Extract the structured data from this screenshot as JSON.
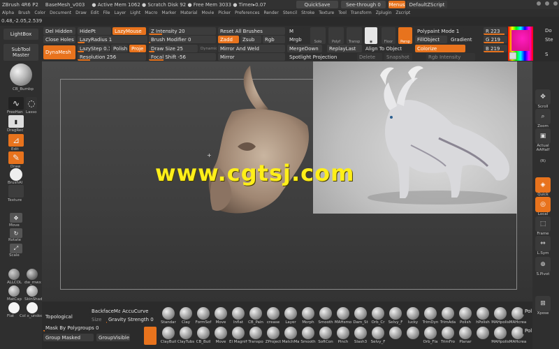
{
  "title_bar": {
    "app": "ZBrush 4R6 P2",
    "file": "BaseMesh_v003",
    "status": "● Active Mem 1062 ● Scratch Disk 92 ● Free Mem 3033 ● Timer▸0.07",
    "quicksave": "QuickSave",
    "see_through": "See-through  0",
    "menus": "Menus",
    "script": "DefaultZScript"
  },
  "menu_bar": [
    "Alpha",
    "Brush",
    "Color",
    "Document",
    "Draw",
    "Edit",
    "File",
    "Layer",
    "Light",
    "Macro",
    "Marker",
    "Material",
    "Movie",
    "Picker",
    "Preferences",
    "Render",
    "Stencil",
    "Stroke",
    "Texture",
    "Tool",
    "Transform",
    "Zplugin",
    "Zscript"
  ],
  "coords": "0.48,-2.05,2.539",
  "left_tray": {
    "lightbox": "LightBox",
    "subtool_master": "SubTool Master",
    "brush_name": "CB_Bumbp",
    "freehand": "FreeHan",
    "lasso": "Lasso",
    "dragrect": "DragRec",
    "edit": "Edit",
    "draw": "Draw",
    "brush_alpha": "BrushAl",
    "texture": "Texture",
    "move": "Move",
    "rotate": "Rotate",
    "scale": "Scale",
    "mat1": "ALLCOL",
    "mat2": "dw_mwx",
    "mat3": "MatCap",
    "mat4": "SkinShad",
    "mat5": "Flat",
    "mat6": "Col x_undoc"
  },
  "top_palette": {
    "del_hidden": "Del Hidden",
    "close_holes": "Close Holes",
    "dynamesh": "DynaMesh",
    "hide_pt": "HidePt",
    "lazy_radius": "LazyRadius 1",
    "lazy_step": "LazyStep 0.1",
    "polish": "Polish",
    "project": "Proje",
    "resolution": "Resolution 256",
    "lazy_mouse": "LazyMouse",
    "z_intensity": "Z Intensity 20",
    "brush_modifier": "Brush Modifier 0",
    "draw_size": "Draw Size 25",
    "dynamic": "Dynamic",
    "focal_shift": "Focal Shift -56",
    "reset_all_brushes": "Reset All Brushes",
    "zadd": "Zadd",
    "zsub": "Zsub",
    "rgb": "Rgb",
    "mirror_and_weld": "Mirror And Weld",
    "mirror": "Mirror",
    "m": "M",
    "mrgb": "Mrgb",
    "mergedown": "MergeDown",
    "spotlight": "Spotlight Projection",
    "solo": "Solo",
    "polyf": "Polyf",
    "transp": "Transp",
    "replay_last": "ReplayLast",
    "align_to_object": "Align To Object",
    "delete": "Delete",
    "snapshot": "Snapshot",
    "floor": "Floor",
    "persp": "Persp",
    "polypaint_mode": "Polypaint Mode 1",
    "fill_object": "FillObject",
    "gradient": "Gradient",
    "colorize": "Colorize",
    "rgb_intensity": "Rgb Intensity",
    "r": "R 223",
    "g": "G 219",
    "b": "B 219",
    "do": "Do",
    "st": "Ste",
    "s": "S"
  },
  "right_tray": [
    "Scroll",
    "Zoom",
    "Actual",
    "AAHalf",
    "(R)",
    "Quick",
    "Local",
    "Frame",
    "L.Sym",
    "S.Pivot",
    "Xpose"
  ],
  "canvas": {
    "watermark": "www.cgtsj.com"
  },
  "bottom_shelf": {
    "topological": "Topological",
    "backface": "BackfaceMas",
    "accucurve": "AccuCurve",
    "size": "Size",
    "gravity": "Gravity Strength 0",
    "mask_by_polygroups": "Mask By Polygroups 0",
    "group_masked": "Group Masked",
    "group_visible": "GroupVisible",
    "row1": [
      "Standar",
      "Clay",
      "FormSof",
      "Move",
      "Inflat",
      "CB_Pain",
      "crease",
      "Layer",
      "Morph",
      "Smooth",
      "MAHsmo",
      "Dam_St",
      "Orb_Cr",
      "Selvy_F",
      "lucky",
      "TrimDyn",
      "TrimAda",
      "Polish",
      "hPolish",
      "MAHpolis",
      "MAHcrea"
    ],
    "row2": [
      "ClayBuil",
      "ClayTubs",
      "CB_Buil",
      "Move",
      "El Magnify",
      "Transpo",
      "ZProject",
      "MatchMa",
      "Smooth",
      "SoftCon",
      "Pinch",
      "Slash3",
      "Selvy_F",
      "",
      "",
      "Orb_Fla",
      "TrimFro",
      "Planar",
      "",
      "MAHpolis",
      "MAHcrea"
    ],
    "pol1": "Pol",
    "pol2": "Pol"
  },
  "colors": {
    "accent": "#e8731d",
    "watermark": "#ffef1a"
  }
}
